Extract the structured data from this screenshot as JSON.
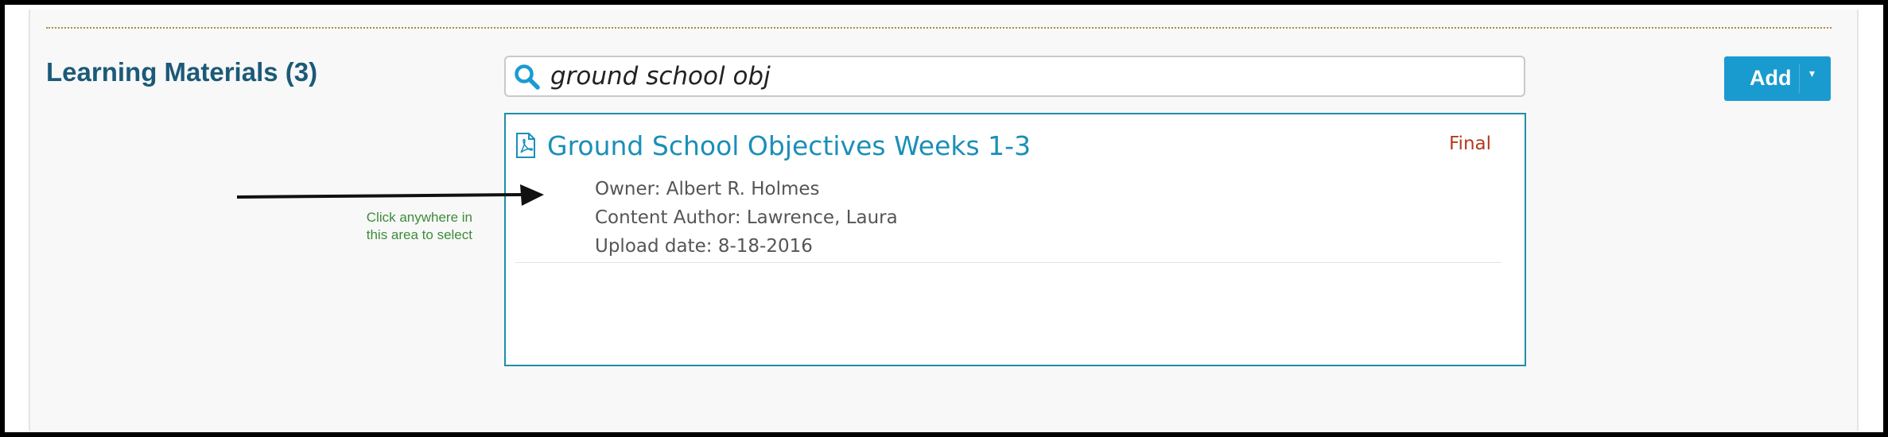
{
  "section": {
    "title": "Learning Materials (3)"
  },
  "search": {
    "value": "ground school obj",
    "icon": "search-icon"
  },
  "add_button": {
    "label": "Add",
    "caret": "▾"
  },
  "results": [
    {
      "icon": "pdf-file-icon",
      "title": "Ground School Objectives Weeks 1-3",
      "status": "Final",
      "owner": "Owner: Albert R. Holmes",
      "author": "Content Author: Lawrence, Laura",
      "upload": "Upload date: 8-18-2016"
    }
  ],
  "annotation": {
    "line1": "Click anywhere in",
    "line2": "this area to select"
  },
  "colors": {
    "title": "#1b5a78",
    "accent": "#1a9bd0",
    "link": "#1a8fb8",
    "status": "#b53a1e",
    "annotation": "#3d8c3a",
    "result_border": "#1f8fa6"
  }
}
